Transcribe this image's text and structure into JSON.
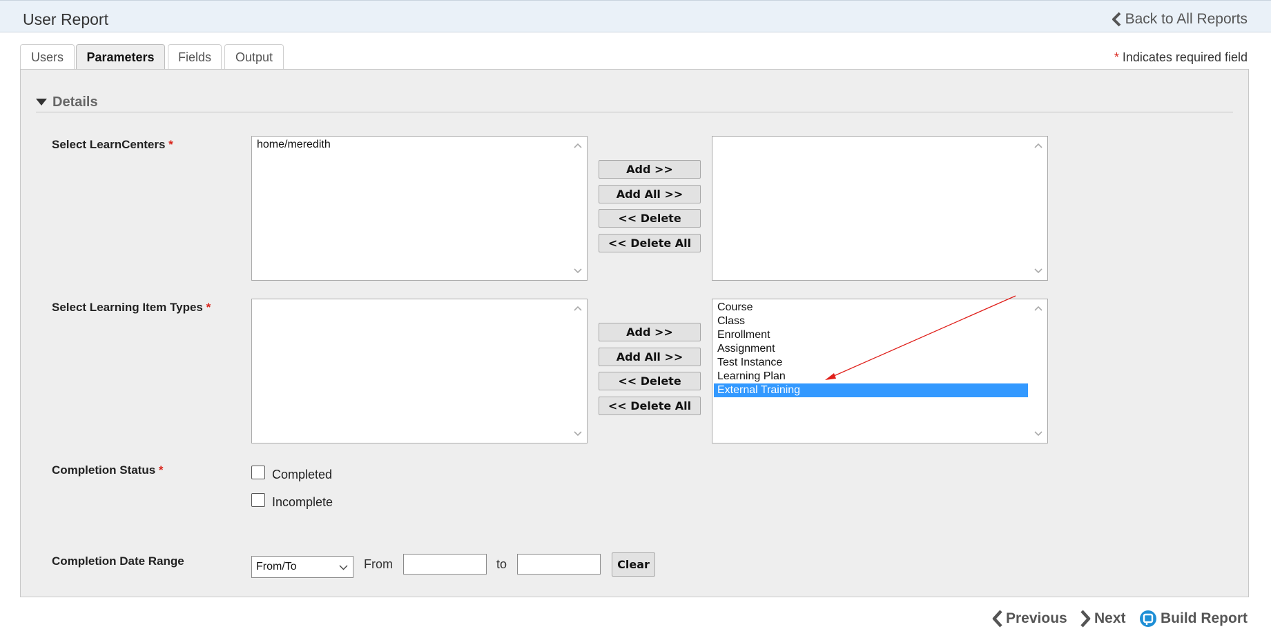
{
  "header": {
    "title": "User Report",
    "back_label": "Back to All Reports"
  },
  "tabs": [
    {
      "label": "Users",
      "active": false
    },
    {
      "label": "Parameters",
      "active": true
    },
    {
      "label": "Fields",
      "active": false
    },
    {
      "label": "Output",
      "active": false
    }
  ],
  "required_note": {
    "star": "*",
    "text": "Indicates required field"
  },
  "section": {
    "title": "Details",
    "icon": "triangle-down-icon"
  },
  "learncenters": {
    "label": "Select LearnCenters",
    "required": "*",
    "available": [
      "home/meredith"
    ],
    "selected": []
  },
  "item_types": {
    "label": "Select Learning Item Types",
    "required": "*",
    "available": [],
    "selected": [
      "Course",
      "Class",
      "Enrollment",
      "Assignment",
      "Test Instance",
      "Learning Plan",
      "External Training"
    ],
    "highlighted": "External Training"
  },
  "buttons": {
    "add": "Add >>",
    "add_all": "Add All >>",
    "delete": "<< Delete",
    "delete_all": "<< Delete All"
  },
  "completion_status": {
    "label": "Completion Status",
    "required": "*",
    "options": [
      {
        "label": "Completed",
        "checked": false
      },
      {
        "label": "Incomplete",
        "checked": false
      }
    ]
  },
  "date_range": {
    "label": "Completion Date Range",
    "mode": "From/To",
    "from_label": "From",
    "to_label": "to",
    "from_value": "",
    "to_value": "",
    "clear_label": "Clear"
  },
  "footer": {
    "previous": "Previous",
    "next": "Next",
    "build": "Build Report"
  },
  "colors": {
    "header_bg": "#eaf1f8",
    "panel_bg": "#eeeeee",
    "selection": "#3399ff",
    "required": "#d9241b",
    "annotation_arrow": "#e0201b"
  }
}
